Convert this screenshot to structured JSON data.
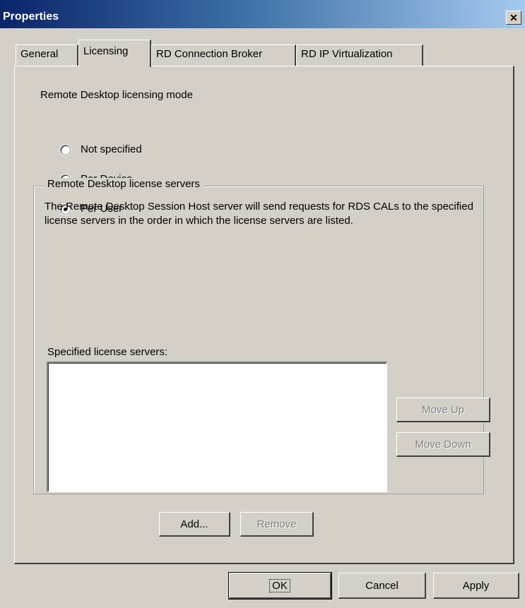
{
  "window": {
    "title": "Properties",
    "close_glyph": "✕"
  },
  "tabs": [
    {
      "label": "General",
      "active": false
    },
    {
      "label": "Licensing",
      "active": true
    },
    {
      "label": "RD Connection Broker",
      "active": false
    },
    {
      "label": "RD IP Virtualization",
      "active": false
    }
  ],
  "licensing": {
    "mode_label": "Remote Desktop licensing mode",
    "options": [
      {
        "label": "Not specified",
        "selected": false
      },
      {
        "label": "Per Device",
        "selected": false
      },
      {
        "label": "Per User",
        "selected": true
      }
    ],
    "servers_group": {
      "legend": "Remote Desktop license servers",
      "description": "The Remote Desktop Session Host server will send requests for RDS CALs to the specified license servers in the order in which the license servers are listed.",
      "list_label": "Specified license servers:",
      "servers": [],
      "move_up_label": "Move Up",
      "move_down_label": "Move Down",
      "add_label": "Add...",
      "remove_label": "Remove"
    }
  },
  "footer": {
    "ok_label": "OK",
    "cancel_label": "Cancel",
    "apply_label": "Apply"
  }
}
